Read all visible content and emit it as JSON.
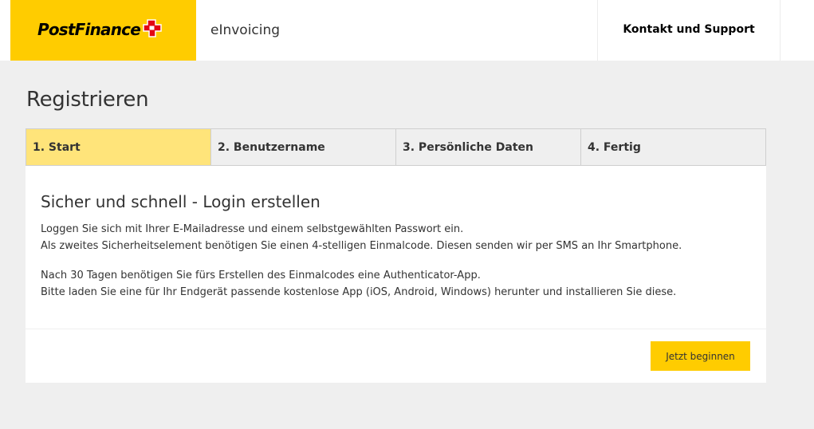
{
  "header": {
    "logo_text": "PostFinance",
    "app_title": "eInvoicing",
    "support_link": "Kontakt und Support",
    "brand_color": "#ffcc00",
    "logo_cross_color": "#e30613"
  },
  "page": {
    "title": "Registrieren"
  },
  "steps": [
    {
      "label": "1. Start",
      "active": true
    },
    {
      "label": "2. Benutzername",
      "active": false
    },
    {
      "label": "3. Persönliche Daten",
      "active": false
    },
    {
      "label": "4. Fertig",
      "active": false
    }
  ],
  "card": {
    "heading": "Sicher und schnell - Login erstellen",
    "paragraph1": [
      "Loggen Sie sich mit Ihrer E-Mailadresse und einem selbstgewählten Passwort ein.",
      "Als zweites Sicherheitselement benötigen Sie einen 4-stelligen Einmalcode. Diesen senden wir per SMS an Ihr Smartphone."
    ],
    "paragraph2": [
      "Nach 30 Tagen benötigen Sie fürs Erstellen des Einmalcodes eine Authenticator-App.",
      "Bitte laden Sie eine für Ihr Endgerät passende kostenlose App (iOS, Android, Windows) herunter und installieren Sie diese."
    ],
    "button_label": "Jetzt beginnen"
  },
  "colors": {
    "active_step": "#ffe47a",
    "button": "#ffcc00",
    "background": "#efefef"
  }
}
